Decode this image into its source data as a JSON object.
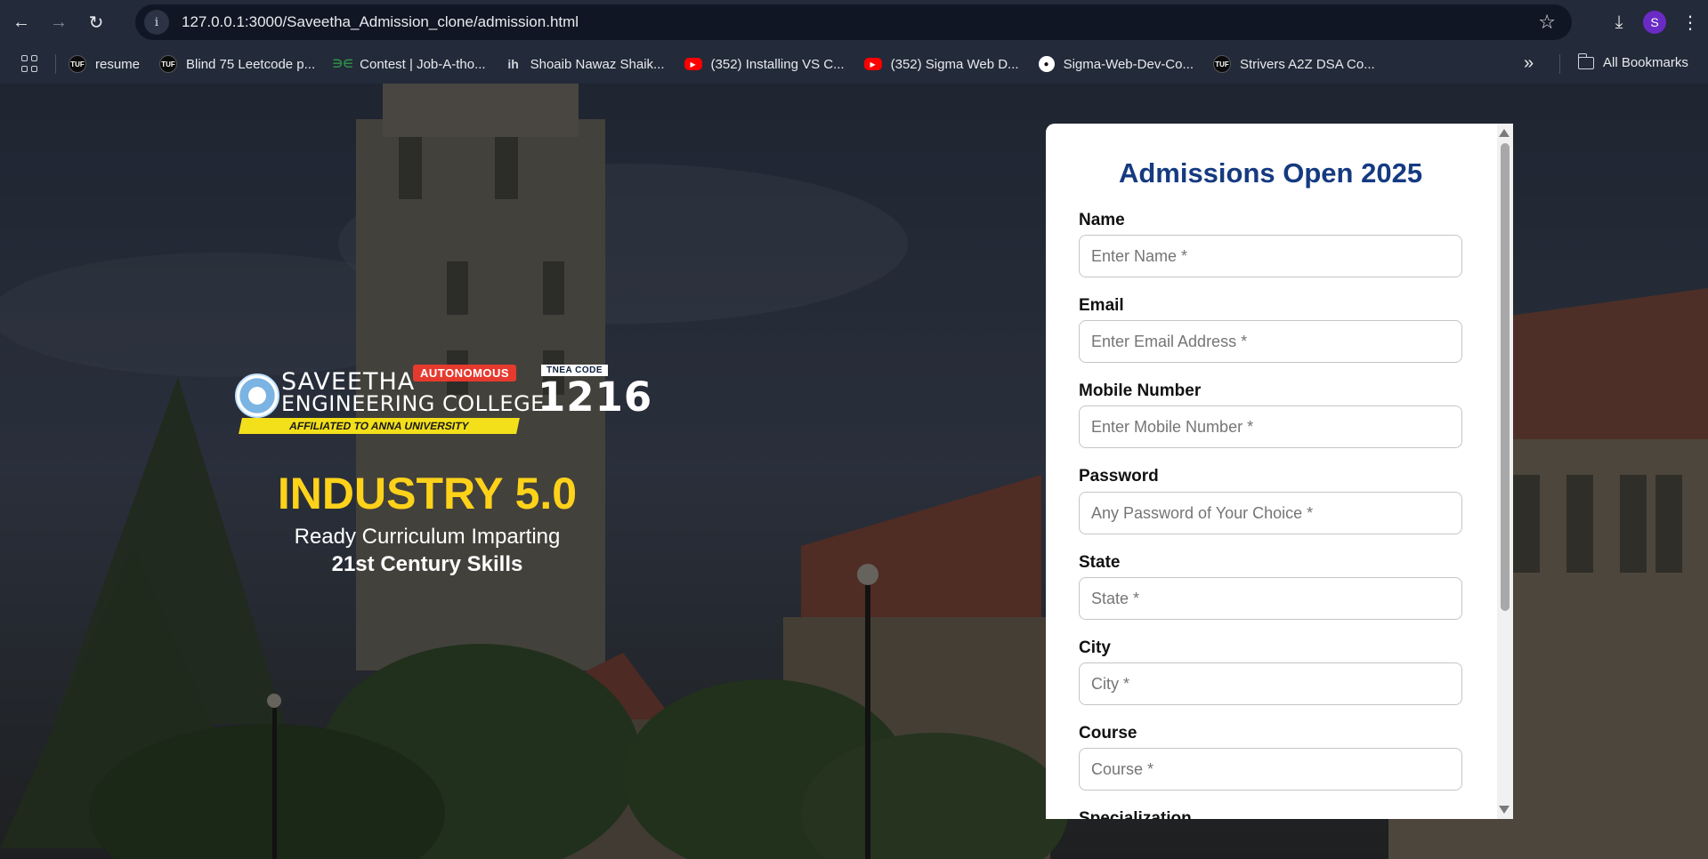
{
  "browser": {
    "url": "127.0.0.1:3000/Saveetha_Admission_clone/admission.html",
    "profile_initial": "S",
    "bookmarks": [
      {
        "label": "resume",
        "icon": "tuf-icon"
      },
      {
        "label": "Blind 75 Leetcode p...",
        "icon": "tuf-icon"
      },
      {
        "label": "Contest | Job-A-tho...",
        "icon": "gfg-icon"
      },
      {
        "label": "Shoaib Nawaz Shaik...",
        "icon": "ih-icon"
      },
      {
        "label": "(352) Installing VS C...",
        "icon": "youtube-icon"
      },
      {
        "label": "(352) Sigma Web D...",
        "icon": "youtube-icon"
      },
      {
        "label": "Sigma-Web-Dev-Co...",
        "icon": "github-icon"
      },
      {
        "label": "Strivers A2Z DSA Co...",
        "icon": "tuf-icon"
      }
    ],
    "more_bookmarks": "»",
    "all_bookmarks": "All Bookmarks"
  },
  "hero": {
    "logo": {
      "line1": "SAVEETHA",
      "line2": "ENGINEERING COLLEGE",
      "badge": "AUTONOMOUS",
      "affiliation": "AFFILIATED TO ANNA UNIVERSITY",
      "tnea_label": "TNEA CODE",
      "tnea_code": "1216"
    },
    "headline": "INDUSTRY 5.0",
    "subline": "Ready Curriculum Imparting",
    "subline_bold": "21st Century Skills"
  },
  "form": {
    "title": "Admissions Open 2025",
    "fields": [
      {
        "label": "Name",
        "placeholder": "Enter Name *"
      },
      {
        "label": "Email",
        "placeholder": "Enter Email Address *"
      },
      {
        "label": "Mobile Number",
        "placeholder": "Enter Mobile Number *"
      },
      {
        "label": "Password",
        "placeholder": "Any Password of Your Choice *"
      },
      {
        "label": "State",
        "placeholder": "State *"
      },
      {
        "label": "City",
        "placeholder": "City *"
      },
      {
        "label": "Course",
        "placeholder": "Course *"
      },
      {
        "label": "Specialization"
      }
    ]
  },
  "colors": {
    "title": "#153a80",
    "headline": "#ffd21a",
    "badge": "#e63a2e",
    "affiliation_band": "#f4e01a"
  }
}
